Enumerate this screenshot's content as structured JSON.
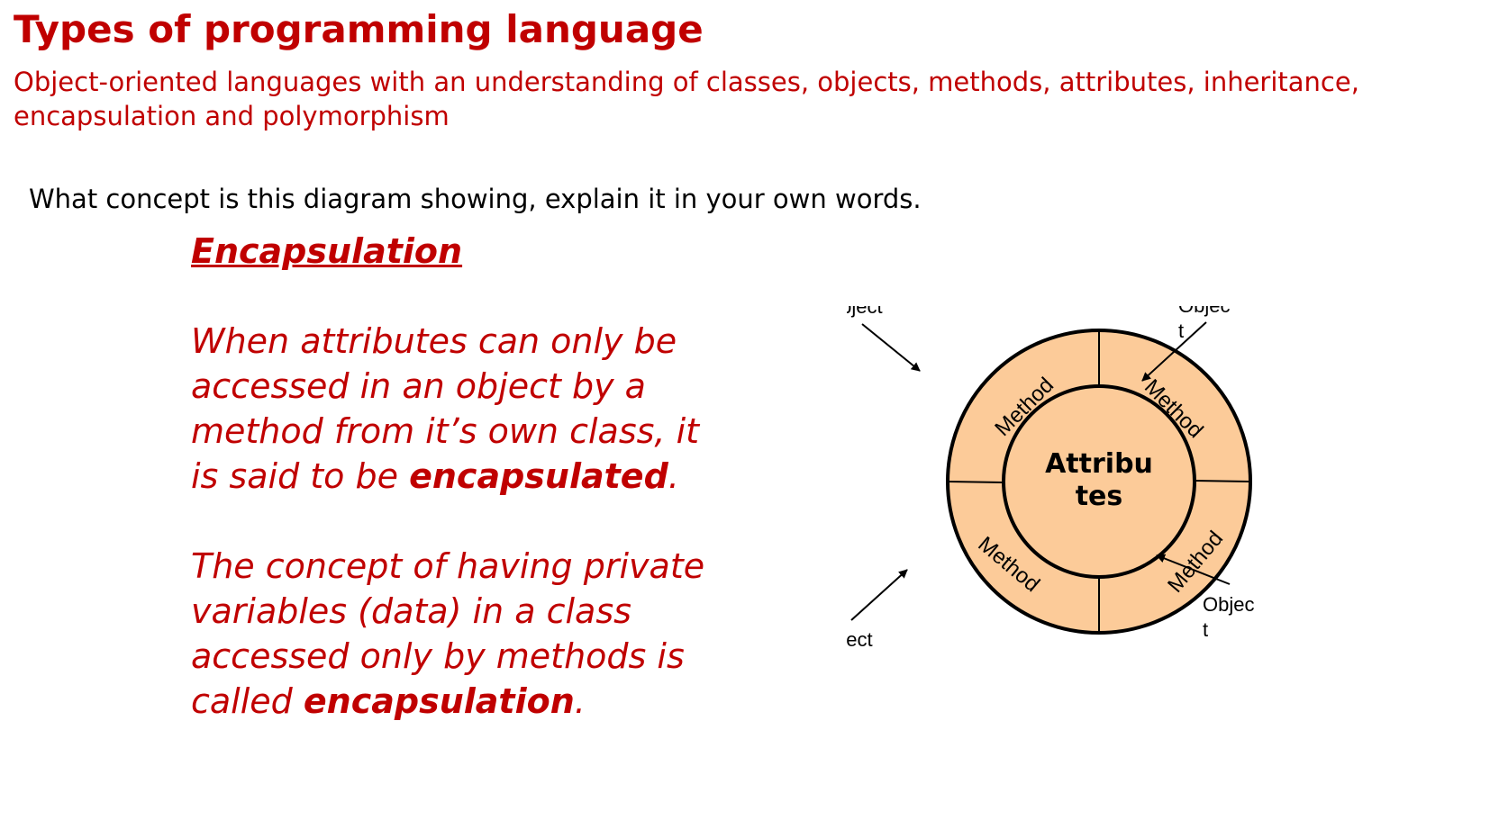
{
  "header": {
    "title": "Types of programming language",
    "subtitle": "Object-oriented languages with an understanding of classes, objects, methods, attributes, inheritance, encapsulation and polymorphism"
  },
  "question": "What concept is this diagram showing, explain it in your own words.",
  "answer": {
    "heading": "Encapsulation",
    "para1_text": "When attributes can only be accessed in an object by a method from it’s own class, it is said to be ",
    "para1_bold": "encapsulated",
    "para1_end": ".",
    "para2_text": "The concept of having private variables (data) in a class accessed only by methods is called ",
    "para2_bold": "encapsulation",
    "para2_end": "."
  },
  "diagram": {
    "center_label_line1": "Attribu",
    "center_label_line2": "tes",
    "method_label": "Method",
    "objects": {
      "top_left": "Object",
      "top_right_line1": "Objec",
      "top_right_line2": "t",
      "bottom_left": "Object",
      "bottom_right_line1": "Objec",
      "bottom_right_line2": "t"
    },
    "colors": {
      "ring_fill": "#fccb99",
      "stroke": "#000000",
      "accent_text": "#c00000"
    }
  }
}
